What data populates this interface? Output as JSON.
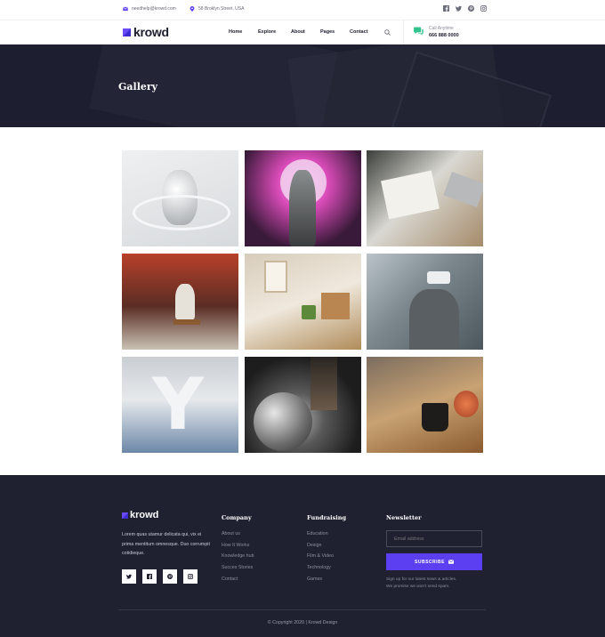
{
  "topbar": {
    "email": "needhelp@krowd.com",
    "address": "58 Broklyn Street, USA",
    "socials": [
      "facebook-icon",
      "twitter-icon",
      "pinterest-icon",
      "instagram-icon"
    ]
  },
  "header": {
    "logo": "krowd",
    "nav": [
      "Home",
      "Explore",
      "About",
      "Pages",
      "Contact"
    ],
    "call_label": "Call Anytime",
    "call_number": "666 888 0000"
  },
  "hero": {
    "title": "Gallery"
  },
  "gallery": {
    "items": [
      "heart-sculpture",
      "neon-figure",
      "sketching-desk",
      "street-painter",
      "workspace-frames",
      "vr-headset",
      "letter-y-sculpture",
      "disco-ball",
      "coffee-cup"
    ]
  },
  "footer": {
    "logo": "krowd",
    "about": "Lorem quas utamur delicata qui, vix ei prima mentitum omnesque. Duo corrumpit cotidieque.",
    "socials": [
      "twitter-icon",
      "facebook-icon",
      "pinterest-icon",
      "instagram-icon"
    ],
    "company": {
      "title": "Company",
      "links": [
        "About us",
        "How It Works",
        "Knowledge hub",
        "Succes Stories",
        "Contact"
      ]
    },
    "fundraising": {
      "title": "Fundraising",
      "links": [
        "Education",
        "Design",
        "Film & Video",
        "Technology",
        "Games"
      ]
    },
    "newsletter": {
      "title": "Newsletter",
      "placeholder": "Email address",
      "button": "SUBSCRIBE",
      "note_line1": "Sign up for our latest news & articles.",
      "note_line2": "We promise we won't send spam."
    },
    "copyright": "© Copyright 2020 | Krowd Design"
  },
  "colors": {
    "accent": "#5b3ff0",
    "dark": "#1f2131",
    "chat": "#32c48d"
  }
}
